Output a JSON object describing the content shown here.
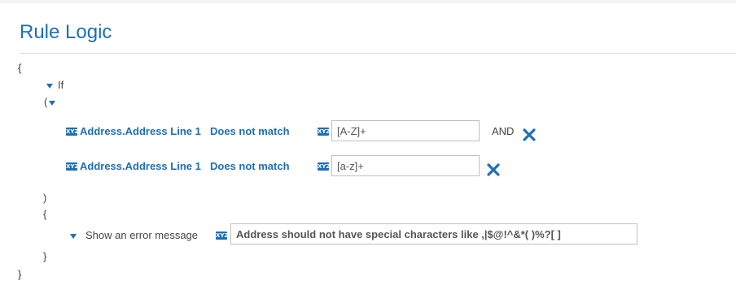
{
  "panel": {
    "title": "Rule Logic"
  },
  "braces": {
    "outer_open": "{",
    "outer_close": "}",
    "cond_close": ")",
    "action_open": "{",
    "action_close": "}"
  },
  "if_block": {
    "label": "If",
    "group_open": "("
  },
  "conditions": [
    {
      "field": "Address.Address Line 1",
      "operator": "Does not match",
      "value": "[A-Z]+",
      "connector": "AND",
      "field_icon": "xyz-field-icon",
      "value_icon": "xyz-value-icon",
      "remove_icon": "close-icon"
    },
    {
      "field": "Address.Address Line 1",
      "operator": "Does not match",
      "value": "[a-z]+",
      "connector": "",
      "field_icon": "xyz-field-icon",
      "value_icon": "xyz-value-icon",
      "remove_icon": "close-icon"
    }
  ],
  "action": {
    "label": "Show an error message",
    "message": "Address should not have special characters like ,|$@!^&*( )%?[ ]",
    "icon": "xyz-value-icon"
  },
  "colors": {
    "accent": "#1e6fb6",
    "text": "#444444",
    "border": "#bfbfbf"
  }
}
